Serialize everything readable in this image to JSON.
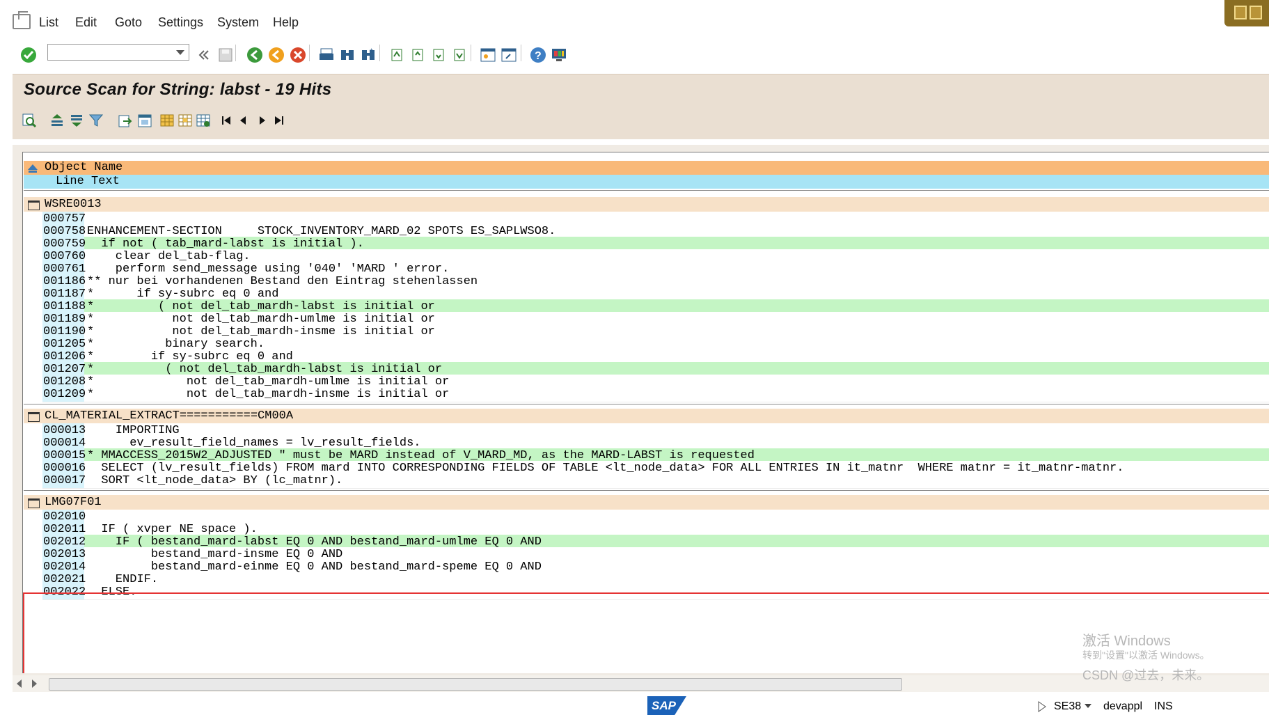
{
  "menu": {
    "items": [
      {
        "label": "List"
      },
      {
        "label": "Edit"
      },
      {
        "label": "Goto"
      },
      {
        "label": "Settings"
      },
      {
        "label": "System"
      },
      {
        "label": "Help"
      }
    ]
  },
  "toolbar": {
    "command_value": ""
  },
  "title": "Source Scan for String: labst - 19 Hits",
  "list_header": {
    "object_name": "Object Name",
    "line_text": "Line Text"
  },
  "groups": [
    {
      "name": "WSRE0013",
      "rows": [
        {
          "line": "000757",
          "text": "",
          "hl": false
        },
        {
          "line": "000758",
          "text": "ENHANCEMENT-SECTION     STOCK_INVENTORY_MARD_02 SPOTS ES_SAPLWSO8.",
          "hl": false
        },
        {
          "line": "000759",
          "text": "  if not ( tab_mard-labst is initial ).",
          "hl": true
        },
        {
          "line": "000760",
          "text": "    clear del_tab-flag.",
          "hl": false
        },
        {
          "line": "000761",
          "text": "    perform send_message using '040' 'MARD ' error.",
          "hl": false
        },
        {
          "line": "001186",
          "text": "** nur bei vorhandenen Bestand den Eintrag stehenlassen",
          "hl": false
        },
        {
          "line": "001187",
          "text": "*      if sy-subrc eq 0 and",
          "hl": false
        },
        {
          "line": "001188",
          "text": "*         ( not del_tab_mardh-labst is initial or",
          "hl": true
        },
        {
          "line": "001189",
          "text": "*           not del_tab_mardh-umlme is initial or",
          "hl": false
        },
        {
          "line": "001190",
          "text": "*           not del_tab_mardh-insme is initial or",
          "hl": false
        },
        {
          "line": "001205",
          "text": "*          binary search.",
          "hl": false
        },
        {
          "line": "001206",
          "text": "*        if sy-subrc eq 0 and",
          "hl": false
        },
        {
          "line": "001207",
          "text": "*          ( not del_tab_mardh-labst is initial or",
          "hl": true
        },
        {
          "line": "001208",
          "text": "*             not del_tab_mardh-umlme is initial or",
          "hl": false
        },
        {
          "line": "001209",
          "text": "*             not del_tab_mardh-insme is initial or",
          "hl": false
        }
      ]
    },
    {
      "name": "CL_MATERIAL_EXTRACT===========CM00A",
      "rows": [
        {
          "line": "000013",
          "text": "    IMPORTING",
          "hl": false
        },
        {
          "line": "000014",
          "text": "      ev_result_field_names = lv_result_fields.",
          "hl": false
        },
        {
          "line": "000015",
          "text": "* MMACCESS_2015W2_ADJUSTED \" must be MARD instead of V_MARD_MD, as the MARD-LABST is requested",
          "hl": true
        },
        {
          "line": "000016",
          "text": "  SELECT (lv_result_fields) FROM mard INTO CORRESPONDING FIELDS OF TABLE <lt_node_data> FOR ALL ENTRIES IN it_matnr  WHERE matnr = it_matnr-matnr.",
          "hl": false
        },
        {
          "line": "000017",
          "text": "  SORT <lt_node_data> BY (lc_matnr).",
          "hl": false
        }
      ]
    },
    {
      "name": "LMG07F01",
      "rows": [
        {
          "line": "002010",
          "text": "",
          "hl": false
        },
        {
          "line": "002011",
          "text": "  IF ( xvper NE space ).",
          "hl": false
        },
        {
          "line": "002012",
          "text": "    IF ( bestand_mard-labst EQ 0 AND bestand_mard-umlme EQ 0 AND",
          "hl": true
        },
        {
          "line": "002013",
          "text": "         bestand_mard-insme EQ 0 AND",
          "hl": false
        },
        {
          "line": "002014",
          "text": "         bestand_mard-einme EQ 0 AND bestand_mard-speme EQ 0 AND",
          "hl": false
        },
        {
          "line": "002021",
          "text": "    ENDIF.",
          "hl": false
        },
        {
          "line": "002022",
          "text": "  ELSE.",
          "hl": false
        }
      ]
    }
  ],
  "status": {
    "sap_logo": "SAP",
    "transaction": "SE38",
    "server": "devappl",
    "mode": "INS"
  },
  "watermark": {
    "line1": "激活 Windows",
    "line2": "转到\"设置\"以激活 Windows。",
    "line3": "CSDN @过去，未来。"
  },
  "colors": {
    "object_header": "#f9b979",
    "line_header": "#a7e4f5",
    "group_header": "#f7e1c8",
    "hit_highlight": "#c4f5c4",
    "annotation_box": "#e53333"
  }
}
